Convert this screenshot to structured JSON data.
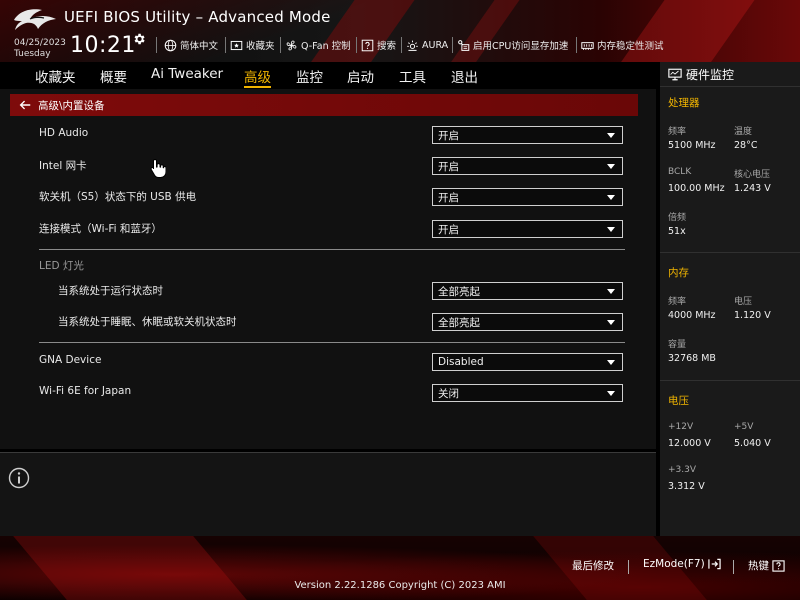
{
  "header": {
    "title": "UEFI BIOS Utility – Advanced Mode",
    "date": "04/25/2023",
    "weekday": "Tuesday",
    "time": "10:21",
    "tools": [
      {
        "label": "简体中文",
        "icon": "globe-icon"
      },
      {
        "label": "收藏夹",
        "icon": "favorites-icon"
      },
      {
        "label": "Q-Fan 控制",
        "icon": "fan-icon"
      },
      {
        "label": "搜索",
        "icon": "search-help-icon"
      },
      {
        "label": "AURA",
        "icon": "aura-light-icon"
      },
      {
        "label": "启用CPU访问显存加速",
        "icon": "resizable-bar-icon"
      },
      {
        "label": "内存稳定性测试",
        "icon": "memtest-icon"
      }
    ]
  },
  "menu": {
    "tabs": [
      "收藏夹",
      "概要",
      "Ai Tweaker",
      "高级",
      "监控",
      "启动",
      "工具",
      "退出"
    ],
    "active_tab": "高级"
  },
  "breadcrumb": "高级\\内置设备",
  "settings": {
    "hd_audio": {
      "label": "HD Audio",
      "value": "开启"
    },
    "intel_lan": {
      "label": "Intel 网卡",
      "value": "开启"
    },
    "usb_power_s5": {
      "label": "软关机（S5）状态下的 USB 供电",
      "value": "开启"
    },
    "connectivity": {
      "label": "连接模式（Wi-Fi 和蓝牙）",
      "value": "开启"
    },
    "led_section": "LED 灯光",
    "led_running": {
      "label": "当系统处于运行状态时",
      "value": "全部亮起"
    },
    "led_sleep": {
      "label": "当系统处于睡眠、休眠或软关机状态时",
      "value": "全部亮起"
    },
    "gna_device": {
      "label": "GNA Device",
      "value": "Disabled"
    },
    "wifi_6e_japan": {
      "label": "Wi-Fi 6E for Japan",
      "value": "关闭"
    }
  },
  "hw_monitor": {
    "title": "硬件监控",
    "cpu": {
      "section": "处理器",
      "freq_label": "频率",
      "freq_value": "5100 MHz",
      "temp_label": "温度",
      "temp_value": "28°C",
      "bclk_label": "BCLK",
      "bclk_value": "100.00 MHz",
      "vcore_label": "核心电压",
      "vcore_value": "1.243 V",
      "ratio_label": "倍频",
      "ratio_value": "51x"
    },
    "memory": {
      "section": "内存",
      "freq_label": "频率",
      "freq_value": "4000 MHz",
      "volt_label": "电压",
      "volt_value": "1.120 V",
      "cap_label": "容量",
      "cap_value": "32768 MB"
    },
    "voltage": {
      "section": "电压",
      "v12_label": "+12V",
      "v12_value": "12.000 V",
      "v5_label": "+5V",
      "v5_value": "5.040 V",
      "v33_label": "+3.3V",
      "v33_value": "3.312 V"
    }
  },
  "footer": {
    "last_modified": "最后修改",
    "ezmode": "EzMode(F7)",
    "hotkeys": "热键",
    "version": "Version 2.22.1286 Copyright (C) 2023 AMI"
  },
  "colors": {
    "accent": "#f0b400",
    "breadcrumb_bg": "#7e0b0b",
    "brand_red": "#b00000"
  }
}
